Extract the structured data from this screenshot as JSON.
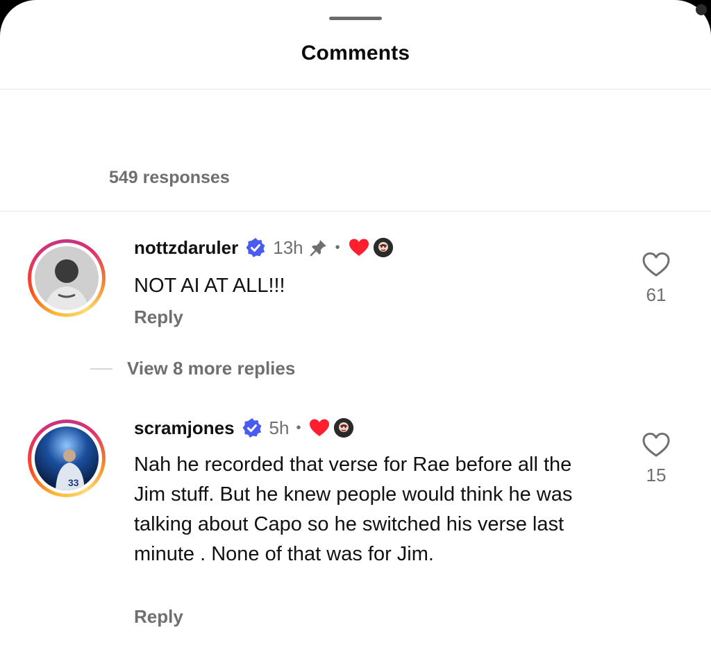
{
  "sheet": {
    "title": "Comments",
    "responses_label": "549 responses"
  },
  "comments": [
    {
      "username": "nottzdaruler",
      "verified": true,
      "time": "13h",
      "pinned": true,
      "creator_liked": true,
      "text": "NOT AI AT ALL!!!",
      "reply_label": "Reply",
      "like_count": "61",
      "avatar_icon": "person-photo"
    },
    {
      "username": "scramjones",
      "verified": true,
      "time": "5h",
      "pinned": false,
      "creator_liked": true,
      "text": "Nah he recorded that verse for Rae before all the Jim stuff. But he knew people would think he was talking about Capo so he switched his verse last minute . None of that was for Jim.",
      "reply_label": "Reply",
      "like_count": "15",
      "avatar_icon": "person-photo"
    }
  ],
  "view_replies": {
    "label": "View 8 more replies"
  },
  "colors": {
    "verified_blue": "#3897f0",
    "heart_red": "#ff3040",
    "secondary_text": "#6f6f6f"
  }
}
